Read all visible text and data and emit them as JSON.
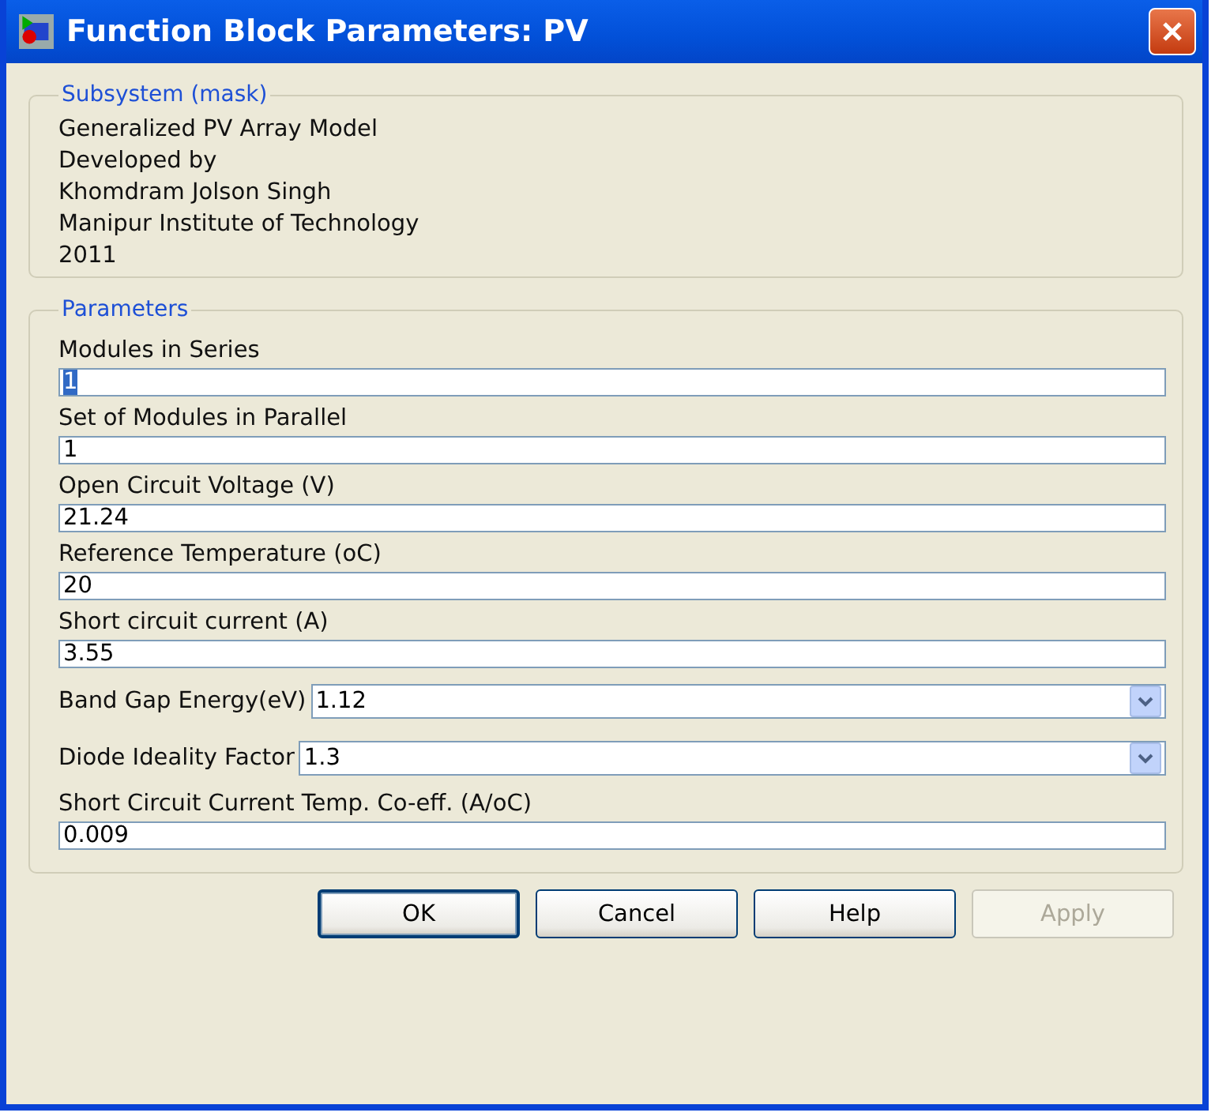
{
  "window": {
    "title": "Function Block Parameters: PV"
  },
  "description": {
    "title": "Subsystem (mask)",
    "lines": [
      "Generalized PV Array Model",
      "Developed by",
      "Khomdram Jolson Singh",
      "Manipur Institute of Technology",
      "2011"
    ]
  },
  "parameters": {
    "title": "Parameters",
    "items": [
      {
        "kind": "edit",
        "label": "Modules in Series",
        "value": "1",
        "highlighted": true
      },
      {
        "kind": "edit",
        "label": "Set of Modules in Parallel",
        "value": "1",
        "highlighted": false
      },
      {
        "kind": "edit",
        "label": "Open Circuit Voltage (V)",
        "value": "21.24",
        "highlighted": false
      },
      {
        "kind": "edit",
        "label": "Reference Temperature (oC)",
        "value": "20",
        "highlighted": false
      },
      {
        "kind": "edit",
        "label": "Short circuit current (A)",
        "value": "3.55",
        "highlighted": false
      },
      {
        "kind": "popup",
        "label": "Band Gap Energy(eV)",
        "value": "1.12",
        "highlighted": false
      },
      {
        "kind": "popup",
        "label": "Diode Ideality Factor",
        "value": "1.3",
        "highlighted": false
      },
      {
        "kind": "edit",
        "label": "Short Circuit Current Temp. Co-eff. (A/oC)",
        "value": "0.009",
        "highlighted": false
      }
    ]
  },
  "buttons": [
    {
      "label": "OK",
      "default": true,
      "disabled": false
    },
    {
      "label": "Cancel",
      "default": false,
      "disabled": false
    },
    {
      "label": "Help",
      "default": false,
      "disabled": false
    },
    {
      "label": "Apply",
      "default": false,
      "disabled": true
    }
  ]
}
